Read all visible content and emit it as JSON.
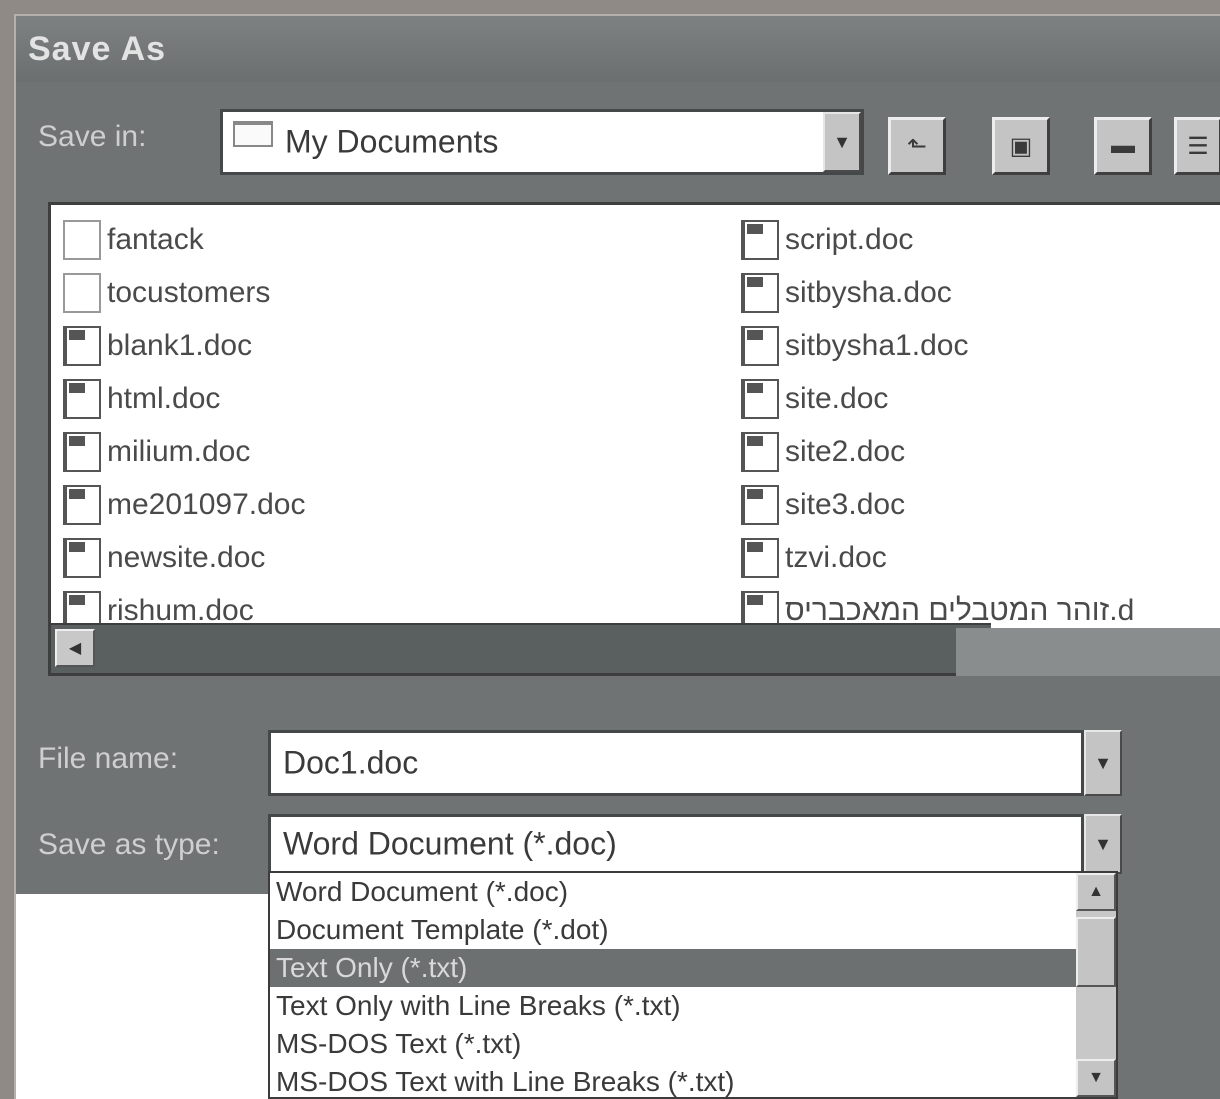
{
  "dialog": {
    "title": "Save As"
  },
  "save_in": {
    "label": "Save in:",
    "value": "My Documents"
  },
  "toolbar": {
    "up_icon": "up-folder-icon",
    "desktop_icon": "desktop-icon",
    "new_folder_icon": "new-folder-icon",
    "list_icon": "list-view-icon"
  },
  "files": {
    "left": [
      {
        "name": "fantack",
        "type": "folder"
      },
      {
        "name": "tocustomers",
        "type": "folder"
      },
      {
        "name": "blank1.doc",
        "type": "doc"
      },
      {
        "name": "html.doc",
        "type": "doc"
      },
      {
        "name": "milium.doc",
        "type": "doc"
      },
      {
        "name": "me201097.doc",
        "type": "doc"
      },
      {
        "name": "newsite.doc",
        "type": "doc"
      },
      {
        "name": "rishum.doc",
        "type": "doc"
      }
    ],
    "right": [
      {
        "name": "script.doc",
        "type": "doc"
      },
      {
        "name": "sitbysha.doc",
        "type": "doc"
      },
      {
        "name": "sitbysha1.doc",
        "type": "doc"
      },
      {
        "name": "site.doc",
        "type": "doc"
      },
      {
        "name": "site2.doc",
        "type": "doc"
      },
      {
        "name": "site3.doc",
        "type": "doc"
      },
      {
        "name": "tzvi.doc",
        "type": "doc"
      },
      {
        "name": "זוהר המטבלים המאכבריס.d",
        "type": "doc"
      }
    ]
  },
  "file_name": {
    "label": "File name:",
    "value": "Doc1.doc"
  },
  "save_as_type": {
    "label": "Save as type:",
    "value": "Word Document (*.doc)",
    "options": [
      "Word Document (*.doc)",
      "Document Template (*.dot)",
      "Text Only (*.txt)",
      "Text Only with Line Breaks (*.txt)",
      "MS-DOS Text (*.txt)",
      "MS-DOS Text with Line Breaks (*.txt)"
    ],
    "highlighted_index": 2
  },
  "colors": {
    "dialog_bg": "#6f7373",
    "selection": "#6c7070",
    "list_bg": "#ffffff"
  }
}
